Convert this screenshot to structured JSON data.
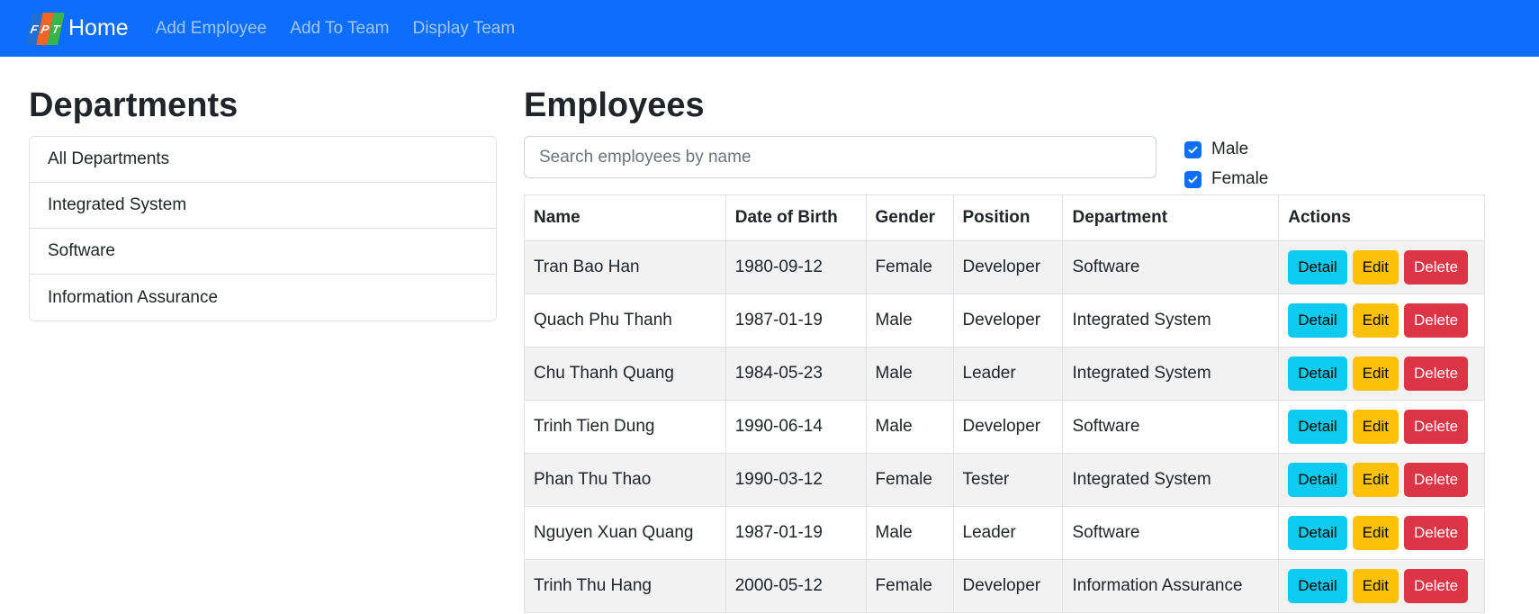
{
  "navbar": {
    "brand": "Home",
    "logo_letters": [
      "F",
      "P",
      "T"
    ],
    "logo_colors": [
      "#1f6fd6",
      "#f26522",
      "#3bb54a"
    ],
    "links": [
      "Add Employee",
      "Add To Team",
      "Display Team"
    ]
  },
  "departments": {
    "title": "Departments",
    "items": [
      "All Departments",
      "Integrated System",
      "Software",
      "Information Assurance"
    ]
  },
  "employees": {
    "title": "Employees",
    "search_placeholder": "Search employees by name",
    "filters": [
      {
        "label": "Male",
        "checked": true
      },
      {
        "label": "Female",
        "checked": true
      }
    ],
    "columns": [
      "Name",
      "Date of Birth",
      "Gender",
      "Position",
      "Department",
      "Actions"
    ],
    "actions": {
      "detail": "Detail",
      "edit": "Edit",
      "delete": "Delete"
    },
    "rows": [
      {
        "name": "Tran Bao Han",
        "dob": "1980-09-12",
        "gender": "Female",
        "position": "Developer",
        "department": "Software"
      },
      {
        "name": "Quach Phu Thanh",
        "dob": "1987-01-19",
        "gender": "Male",
        "position": "Developer",
        "department": "Integrated System"
      },
      {
        "name": "Chu Thanh Quang",
        "dob": "1984-05-23",
        "gender": "Male",
        "position": "Leader",
        "department": "Integrated System"
      },
      {
        "name": "Trinh Tien Dung",
        "dob": "1990-06-14",
        "gender": "Male",
        "position": "Developer",
        "department": "Software"
      },
      {
        "name": "Phan Thu Thao",
        "dob": "1990-03-12",
        "gender": "Female",
        "position": "Tester",
        "department": "Integrated System"
      },
      {
        "name": "Nguyen Xuan Quang",
        "dob": "1987-01-19",
        "gender": "Male",
        "position": "Leader",
        "department": "Software"
      },
      {
        "name": "Trinh Thu Hang",
        "dob": "2000-05-12",
        "gender": "Female",
        "position": "Developer",
        "department": "Information Assurance"
      }
    ]
  },
  "colors": {
    "navbar": "#0d6efd",
    "detail": "#0dcaf0",
    "edit": "#ffc107",
    "delete": "#dc3545",
    "checkbox": "#0d6efd"
  }
}
